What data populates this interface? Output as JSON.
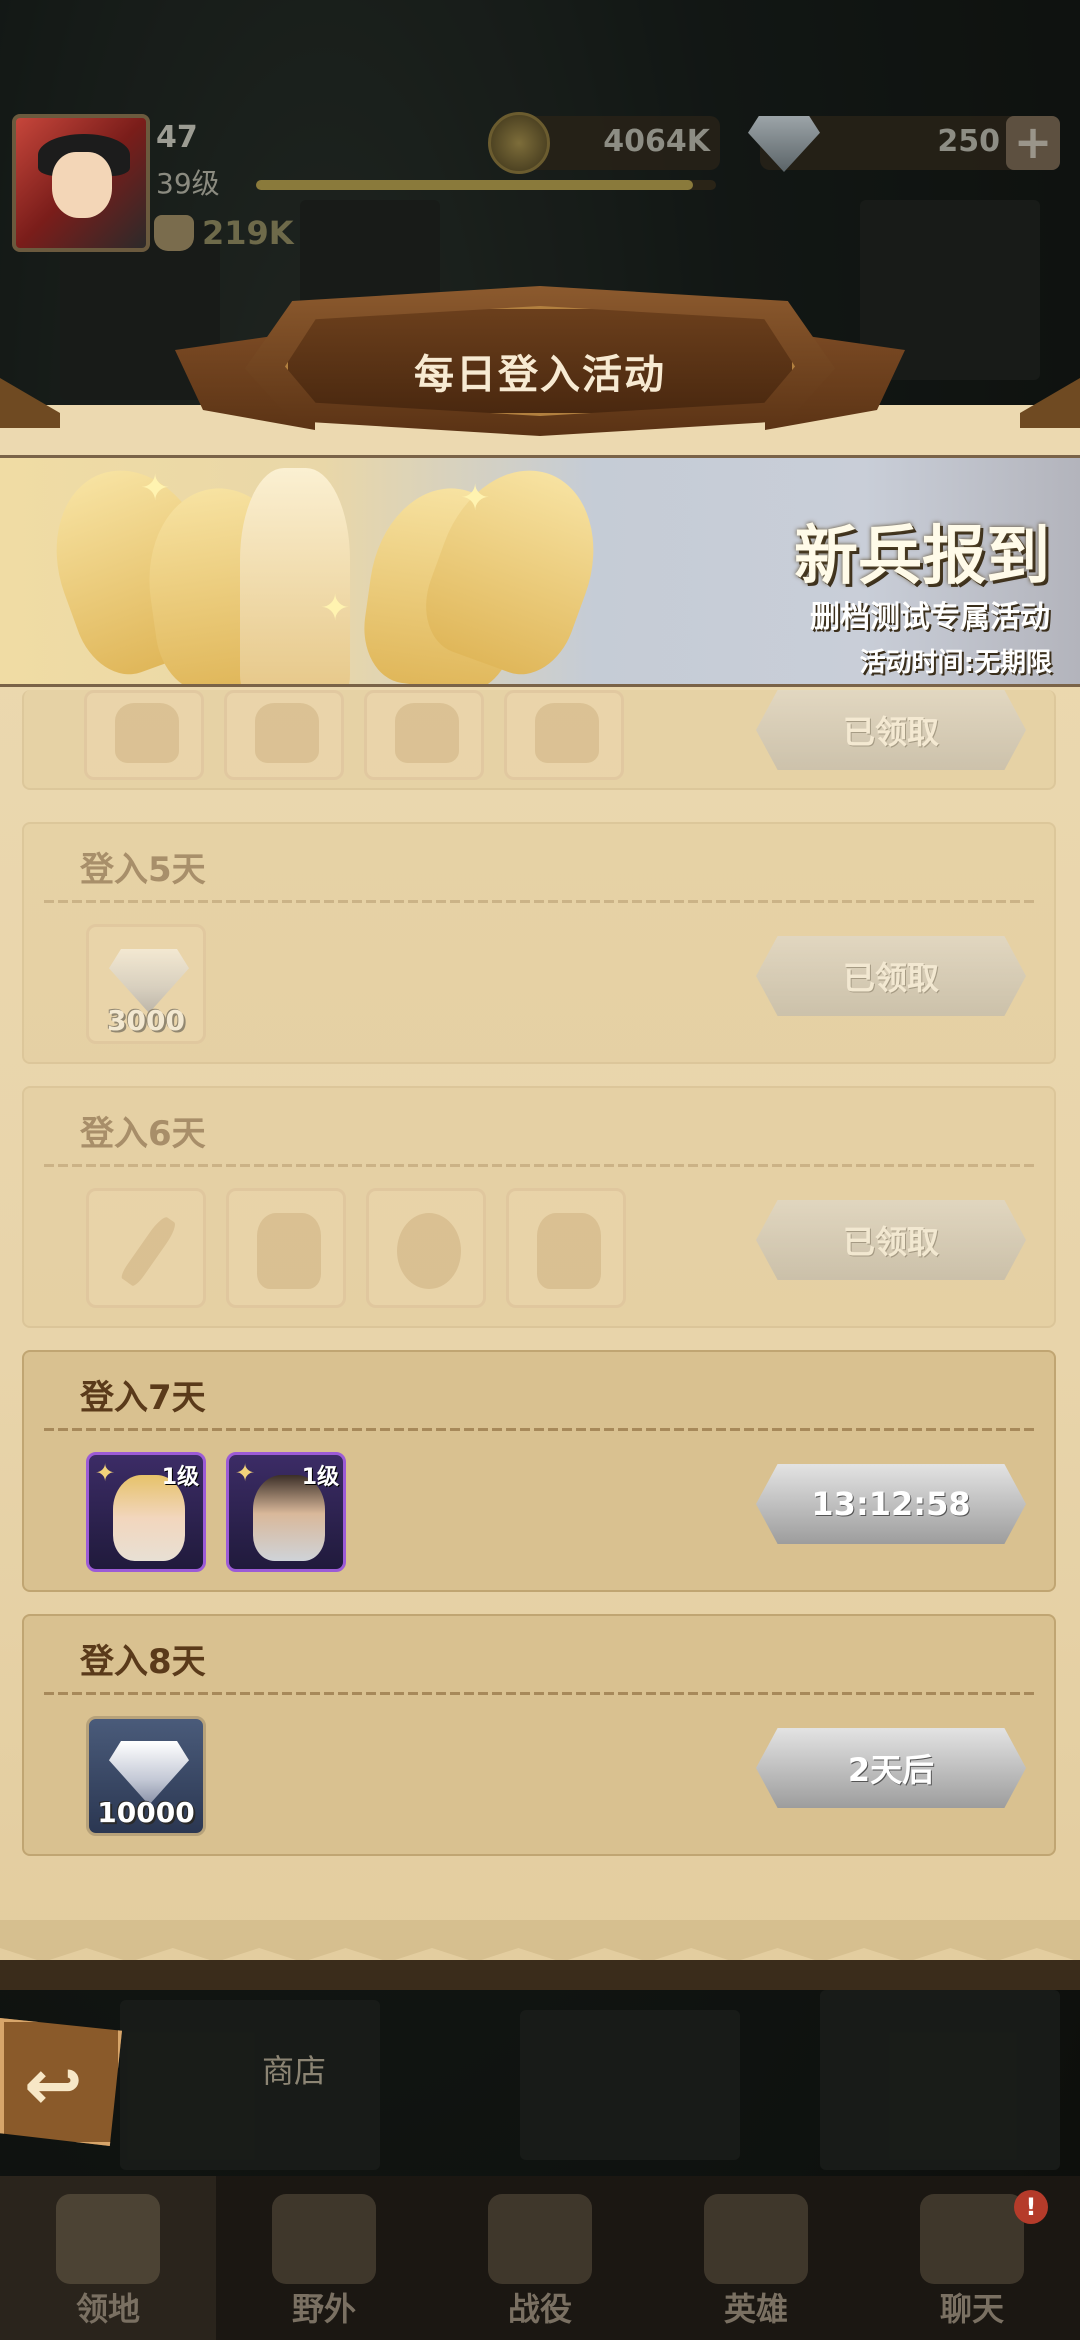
{
  "player": {
    "name_level": "47",
    "rank": "39级",
    "power": "219K",
    "gold": "4064K",
    "gems": "250",
    "xp_fraction": 0.95
  },
  "popup": {
    "title": "每日登入活动",
    "banner": {
      "title": "新兵报到",
      "subtitle": "删档测试专属活动",
      "time": "活动时间:无期限"
    }
  },
  "days": [
    {
      "label": "",
      "status": "已领取",
      "state": "claimed"
    },
    {
      "label": "登入5天",
      "status": "已领取",
      "state": "claimed",
      "rewards": [
        {
          "type": "diamond",
          "qty": "3000"
        }
      ]
    },
    {
      "label": "登入6天",
      "status": "已领取",
      "state": "claimed"
    },
    {
      "label": "登入7天",
      "status": "13:12:58",
      "state": "pending",
      "rewards": [
        {
          "badge": "1级"
        },
        {
          "badge": "1级"
        }
      ]
    },
    {
      "label": "登入8天",
      "status": "2天后",
      "state": "locked",
      "rewards": [
        {
          "type": "diamond",
          "qty": "10000"
        }
      ]
    }
  ],
  "map": {
    "shop_label": "商店"
  },
  "nav": [
    {
      "label": "领地",
      "icon": "castle-icon"
    },
    {
      "label": "野外",
      "icon": "scroll-map-icon"
    },
    {
      "label": "战役",
      "icon": "crossed-swords-icon"
    },
    {
      "label": "英雄",
      "icon": "helmet-icon"
    },
    {
      "label": "聊天",
      "icon": "chat-bubble-icon",
      "alert": "!"
    }
  ],
  "colors": {
    "panel": "#ecd9b0",
    "title_plate": "#6b3f1c",
    "button_gray": "#a9a9a9",
    "hero_frame": "#9c5bd6"
  }
}
